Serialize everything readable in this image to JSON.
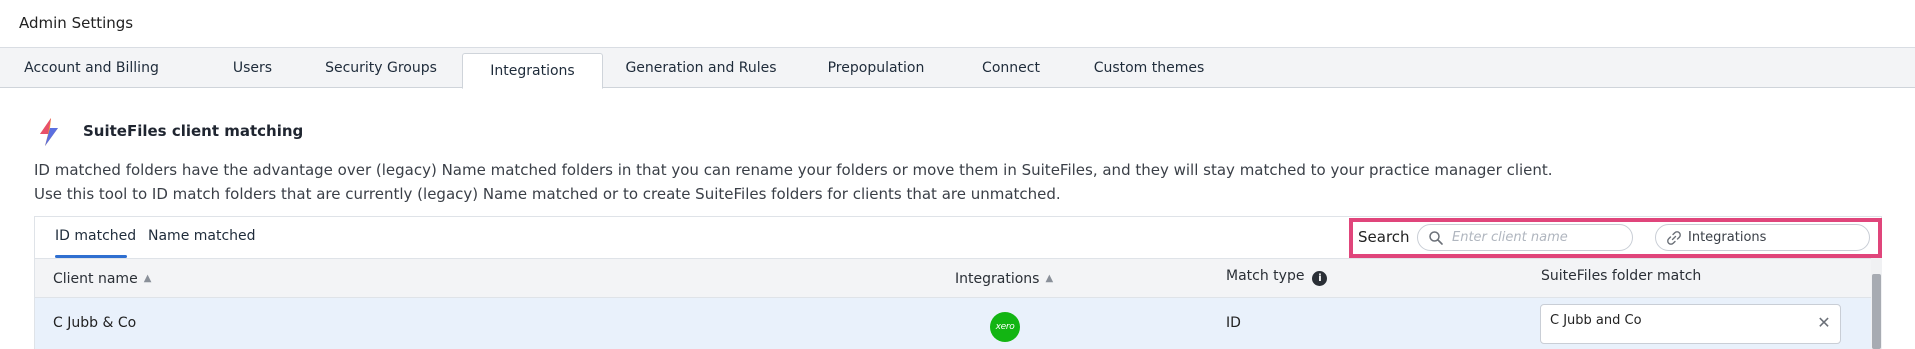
{
  "window": {
    "title": "Admin Settings"
  },
  "tabs": [
    {
      "label": "Account and Billing"
    },
    {
      "label": "Users"
    },
    {
      "label": "Security Groups"
    },
    {
      "label": "Integrations",
      "active": true
    },
    {
      "label": "Generation and Rules"
    },
    {
      "label": "Prepopulation"
    },
    {
      "label": "Connect"
    },
    {
      "label": "Custom themes"
    }
  ],
  "section": {
    "icon": "lightning-bolt-icon",
    "title": "SuiteFiles client matching",
    "description": [
      "ID matched folders have the advantage over (legacy) Name matched folders in that you can rename your folders or move them in SuiteFiles, and they will stay matched to your practice manager client.",
      "Use this tool to ID match folders that are currently (legacy) Name matched or to create SuiteFiles folders for clients that are unmatched."
    ]
  },
  "panel": {
    "subtabs": [
      {
        "label": "ID matched",
        "active": true
      },
      {
        "label": "Name matched"
      }
    ],
    "search": {
      "label": "Search",
      "placeholder": "Enter client name",
      "integration_filter": "Integrations"
    },
    "table": {
      "columns": [
        "Client name",
        "Integrations",
        "Match type",
        "SuiteFiles folder match"
      ],
      "rows": [
        {
          "client_name": "C Jubb & Co",
          "integration": "xero",
          "integration_logo_text": "xero",
          "match_type": "ID",
          "folder_match": "C Jubb and Co"
        }
      ]
    }
  },
  "colors": {
    "accent": "#2f6fd0",
    "highlight": "#e0457b",
    "xero": "#13b513",
    "row_selected": "#e9f1fb"
  }
}
